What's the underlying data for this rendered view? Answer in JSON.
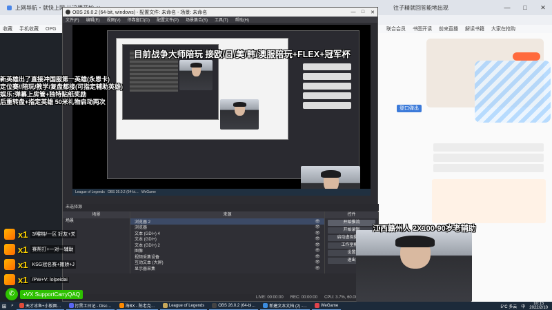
{
  "browser": {
    "tabs": [
      {
        "label": "上网导航・就快上网 从这里开始"
      },
      {
        "label": "往子精就回答能地出现"
      }
    ],
    "bookmarks": [
      "收藏",
      "手机收藏",
      "OPG"
    ],
    "bookmarks_right": [
      "联合会员",
      "书图开读",
      "前来直播",
      "解读书籍",
      "大家在抢购"
    ],
    "login_button": "登口弹出"
  },
  "obs": {
    "title": "OBS 26.0.2 (64-bit, windows) - 配置文件: 未命名 - 场景: 未命名",
    "menu": [
      "文件(F)",
      "编辑(E)",
      "视图(V)",
      "停靠窗口(D)",
      "配置文件(P)",
      "场景集合(S)",
      "工具(T)",
      "帮助(H)"
    ],
    "window_controls": [
      "—",
      "□",
      "✕"
    ],
    "docks_header": "未选择源",
    "scenes_label": "场景",
    "sources_label": "来源",
    "controls_label": "控件",
    "scene_items": [
      "场景"
    ],
    "sources": [
      {
        "name": "浏览器 2"
      },
      {
        "name": "浏览器"
      },
      {
        "name": "文本 (GDI+) 4"
      },
      {
        "name": "文本 (GDI+)"
      },
      {
        "name": "文本 (GDI+) 2"
      },
      {
        "name": "图像"
      },
      {
        "name": "视频采集设备"
      },
      {
        "name": "互动文本 (大屏)"
      },
      {
        "name": "显示器采集"
      }
    ],
    "controls": [
      "开始推流",
      "开始录制",
      "启动虚拟摄像机",
      "工作室模式",
      "设置",
      "退出"
    ],
    "dock_tabs_left": [
      "来源",
      "场景"
    ],
    "dock_tabs_right": [
      "控件",
      "转场特效"
    ],
    "status": [
      "LIVE: 00:00:00",
      "REC: 00:00:00",
      "CPU: 3.7%, 60.00 fps"
    ]
  },
  "overlay": {
    "title": "目前战争大师陪玩 接欧/日/美/韩/澳服陪玩+FLEX+冠军杯",
    "lines": [
      "新英雄出了直接冲国服第一英雄(永恩卡)",
      "定位赛//陪玩/教学/复盘都接(可指定辅助英雄)",
      "娱乐:弹幕上房管+独特贴纸奖励",
      "后重转盘+指定英雄 50米礼物启动两次"
    ],
    "webcam_caption": "江西赣州人 2X100-90岁老辅助"
  },
  "gifts": [
    {
      "count": "x1",
      "text": "3/喉特/一区 好友+关"
    },
    {
      "count": "x1",
      "text": "赛帮打+一对一辅助"
    },
    {
      "count": "x1",
      "text": "KSG冠名赛+撒娇+J"
    },
    {
      "count": "x1",
      "text": "/PW+V: lolpeidai"
    }
  ],
  "wechat": {
    "label": "+VX SupportCarryQAQ"
  },
  "taskbar": {
    "items": [
      {
        "label": "天才冰鱼+小板面…",
        "color": "#e04b3a"
      },
      {
        "label": "打黑工日记 - Disc…",
        "color": "#5865f2"
      },
      {
        "label": "海BX - 陈老克…",
        "color": "#ff8a00"
      },
      {
        "label": "League of Legends",
        "color": "#c8a85a"
      },
      {
        "label": "OBS 26.0.2 (64-bi…",
        "color": "#444444"
      },
      {
        "label": "新建文本文档 (2) -…",
        "color": "#3c8de0"
      },
      {
        "label": "WeGame",
        "color": "#e0434b"
      }
    ],
    "weather": "5°C 多云",
    "time": "10:15",
    "date": "2022/2/10",
    "lang": "中"
  }
}
